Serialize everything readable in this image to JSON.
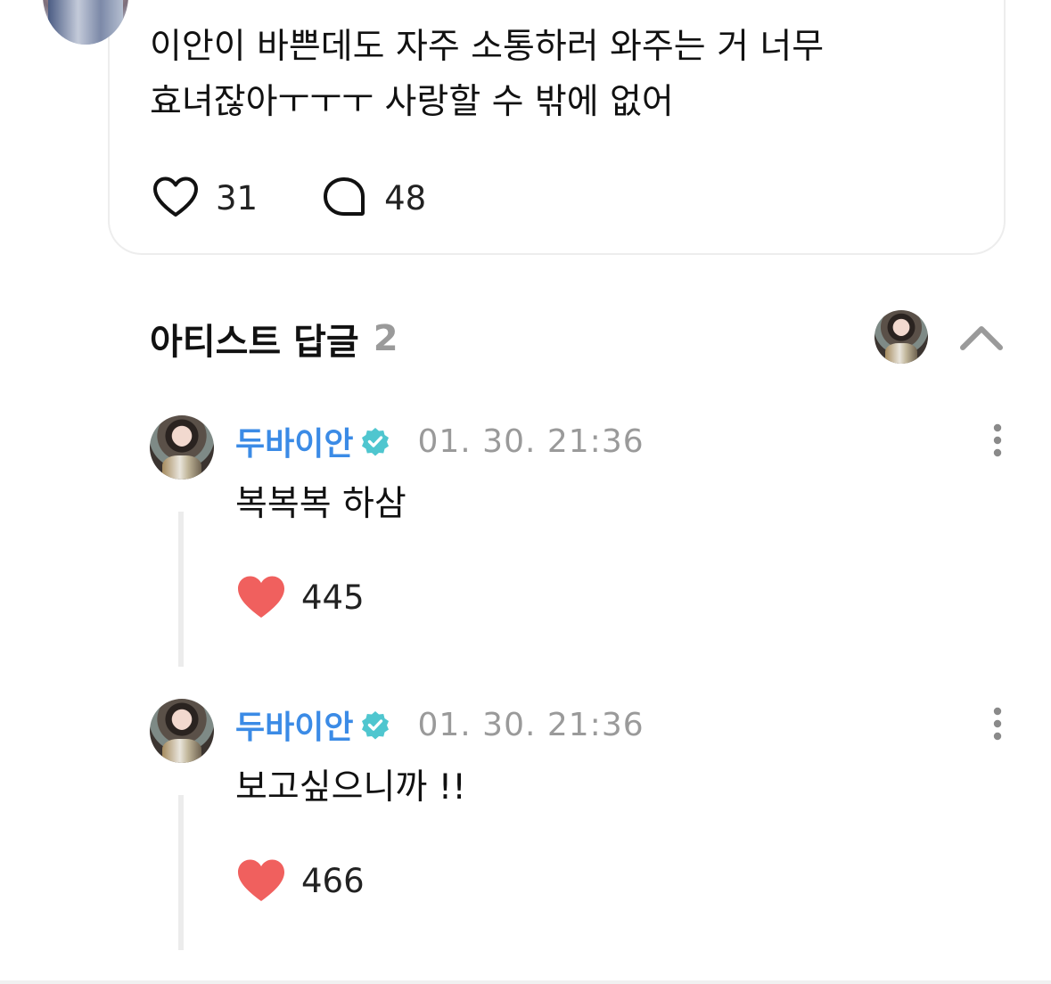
{
  "post": {
    "text_line1": "이안이 바쁜데도 자주 소통하러 와주는 거 너무",
    "text_line2": "효녀잖아ㅜㅜㅜ 사랑할 수 밖에 없어",
    "likes": "31",
    "comments": "48",
    "like_icon": "heart-outline-icon",
    "comment_icon": "speech-bubble-icon"
  },
  "artist_replies": {
    "title": "아티스트 답글",
    "count": "2",
    "collapse_icon": "chevron-up-icon"
  },
  "replies": [
    {
      "author": "두바이안",
      "verified": true,
      "date": "01. 30. 21:36",
      "text": "복복복 하삼",
      "likes": "445"
    },
    {
      "author": "두바이안",
      "verified": true,
      "date": "01. 30. 21:36",
      "text": "보고싶으니까 !!",
      "likes": "466"
    }
  ],
  "colors": {
    "author_name": "#3b8be6",
    "verified_badge": "#4fc6cf",
    "heart_filled": "#f0605e",
    "muted_text": "#9a9a9a",
    "card_border": "#ededed",
    "thread_line": "#ececec"
  }
}
